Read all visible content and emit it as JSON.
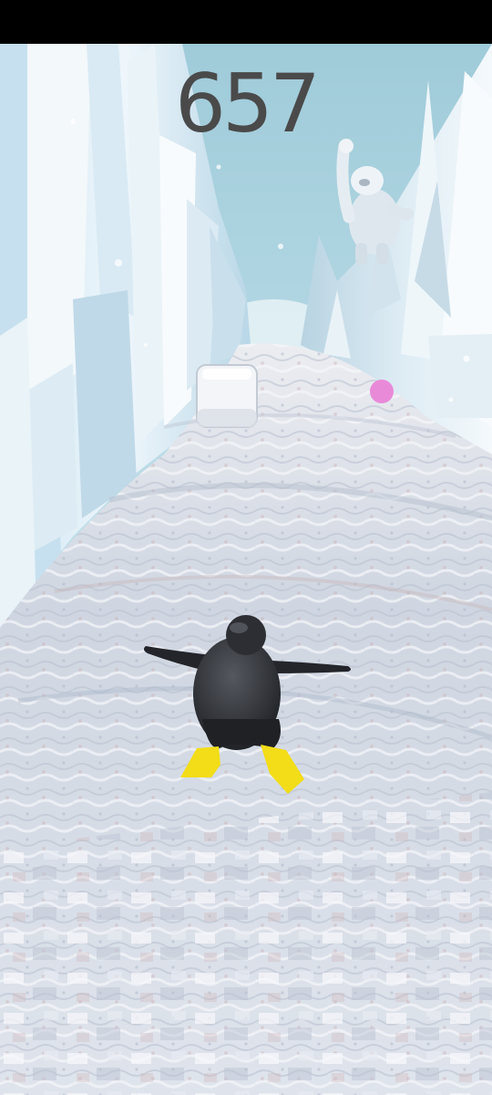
{
  "hud": {
    "score": "657"
  },
  "colors": {
    "sky": "#bfe3ee",
    "ice_wall": "#e6f1f7",
    "ice_shadow": "#9cc6dc",
    "slide_surface": "#d9dde6",
    "penguin_body": "#2a2c31",
    "penguin_feet": "#f2dd18",
    "pink_orb": "#e98ad9",
    "score_text": "#4a4a4a"
  },
  "icons": {
    "player": "penguin-sprite",
    "enemy": "yeti-sprite",
    "obstacle": "ice-cube",
    "pickup": "pink-orb"
  }
}
